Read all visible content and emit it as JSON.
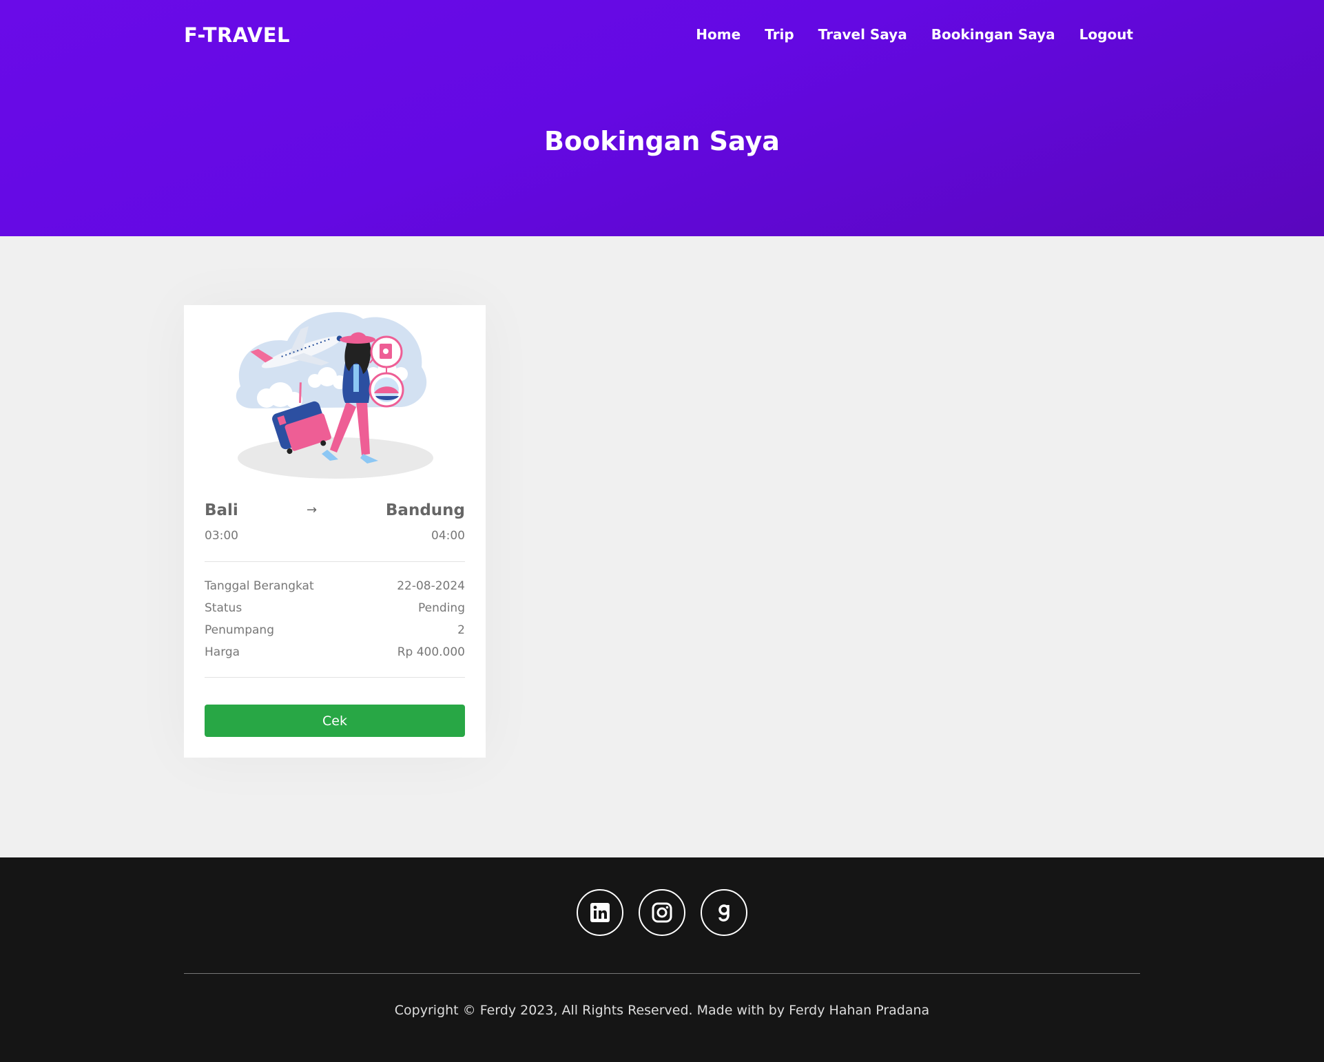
{
  "header": {
    "brand": "F-TRAVEL",
    "nav": [
      "Home",
      "Trip",
      "Travel Saya",
      "Bookingan Saya",
      "Logout"
    ],
    "page_title": "Bookingan Saya"
  },
  "booking": {
    "from_city": "Bali",
    "arrow": "→",
    "to_city": "Bandung",
    "depart_time": "03:00",
    "arrive_time": "04:00",
    "details": [
      {
        "label": "Tanggal Berangkat",
        "value": "22-08-2024"
      },
      {
        "label": "Status",
        "value": "Pending"
      },
      {
        "label": "Penumpang",
        "value": "2"
      },
      {
        "label": "Harga",
        "value": "Rp 400.000"
      }
    ],
    "button": "Cek"
  },
  "footer": {
    "socials": [
      "linkedin-icon",
      "instagram-icon",
      "goodreads-icon"
    ],
    "copyright": "Copyright © Ferdy 2023, All Rights Reserved. Made with by Ferdy Hahan Pradana"
  },
  "colors": {
    "hero": "#6409e3",
    "button": "#28a745",
    "footer": "#151515"
  }
}
